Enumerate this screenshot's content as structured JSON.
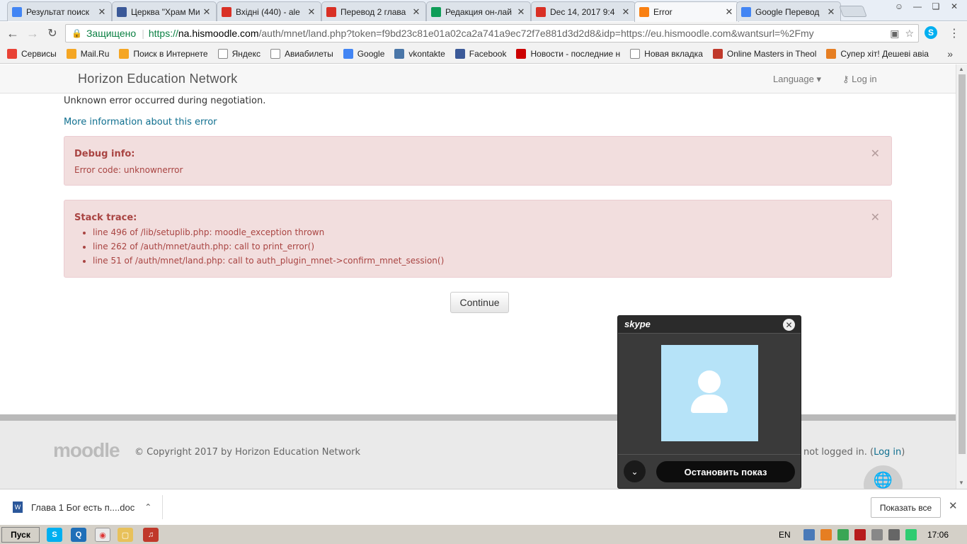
{
  "browser": {
    "tabs": [
      {
        "title": "Результат поиск",
        "favicon": "google-icon",
        "color": "#4285f4",
        "active": false
      },
      {
        "title": "Церква \"Храм Ми",
        "favicon": "facebook-icon",
        "color": "#3b5998",
        "active": false
      },
      {
        "title": "Вхідні (440) - ale",
        "favicon": "gmail-icon",
        "color": "#d93025",
        "active": false
      },
      {
        "title": "Перевод 2 глава",
        "favicon": "gmail-icon",
        "color": "#d93025",
        "active": false
      },
      {
        "title": "Редакция он-лай",
        "favicon": "drive-icon",
        "color": "#0f9d58",
        "active": false
      },
      {
        "title": "Dec 14, 2017 9:4",
        "favicon": "calendar-icon",
        "color": "#d93025",
        "active": false
      },
      {
        "title": "Error",
        "favicon": "moodle-icon",
        "color": "#f98012",
        "active": true
      },
      {
        "title": "Google Перевод",
        "favicon": "translate-icon",
        "color": "#4285f4",
        "active": false
      }
    ],
    "omnibox": {
      "secure_label": "Защищено",
      "url_scheme": "https://",
      "url_host": "na.hismoodle.com",
      "url_rest": "/auth/mnet/land.php?token=f9bd23c81e01a02ca2a741a9ec72f7e881d3d2d8&idp=https://eu.hismoodle.com&wantsurl=%2Fmy"
    },
    "bookmarks": [
      {
        "label": "Сервисы",
        "icon": "apps-grid-icon",
        "color": "#e94235"
      },
      {
        "label": "Mail.Ru",
        "icon": "mailru-icon",
        "color": "#f5a623"
      },
      {
        "label": "Поиск в Интернете",
        "icon": "search-icon",
        "color": "#f5a623"
      },
      {
        "label": "Яндекс",
        "icon": "page-icon",
        "color": "#ffffff"
      },
      {
        "label": "Авиабилеты",
        "icon": "page-icon",
        "color": "#ffffff"
      },
      {
        "label": "Google",
        "icon": "google-icon",
        "color": "#4285f4"
      },
      {
        "label": "vkontakte",
        "icon": "vk-icon",
        "color": "#4a76a8"
      },
      {
        "label": "Facebook",
        "icon": "facebook-icon",
        "color": "#3b5998"
      },
      {
        "label": "Новости - последние н",
        "icon": "news-icon",
        "color": "#cc0000"
      },
      {
        "label": "Новая вкладка",
        "icon": "page-icon",
        "color": "#ffffff"
      },
      {
        "label": "Online Masters in Theol",
        "icon": "ww-icon",
        "color": "#c0392b"
      },
      {
        "label": "Супер хіт! Дешеві авіа",
        "icon": "flag-icon",
        "color": "#e67e22"
      }
    ]
  },
  "site": {
    "brand": "Horizon Education Network",
    "language": "Language",
    "login": "Log in"
  },
  "error": {
    "message": "Unknown error occurred during negotiation.",
    "more_info": "More information about this error",
    "debug_title": "Debug info:",
    "debug_code": "Error code: unknownerror",
    "stack_title": "Stack trace:",
    "stack": [
      "line 496 of /lib/setuplib.php: moodle_exception thrown",
      "line 262 of /auth/mnet/auth.php: call to print_error()",
      "line 51 of /auth/mnet/land.php: call to auth_plugin_mnet->confirm_mnet_session()"
    ],
    "continue": "Continue"
  },
  "footer": {
    "logo": "moodle",
    "copyright": "© Copyright 2017 by Horizon Education Network",
    "not_logged_prefix": "not logged in. (",
    "not_logged_link": "Log in",
    "not_logged_suffix": ")"
  },
  "skype": {
    "logo": "skype",
    "stop_label": "Остановить показ"
  },
  "downloads": {
    "file": "Глава 1 Бог есть п....doc",
    "show_all": "Показать все"
  },
  "taskbar": {
    "start": "Пуск",
    "lang": "EN",
    "clock": "17:06"
  }
}
